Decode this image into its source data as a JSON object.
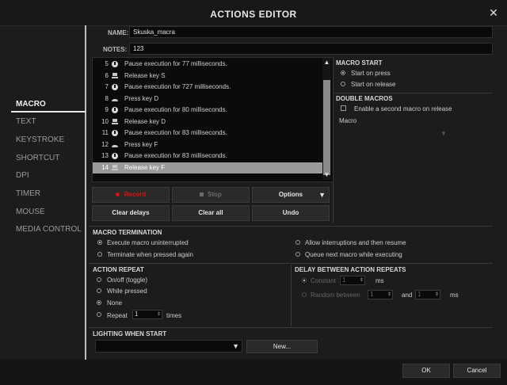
{
  "window": {
    "title": "ACTIONS EDITOR",
    "close_icon": "close-icon"
  },
  "sidebar": {
    "items": [
      {
        "label": "MACRO",
        "active": true
      },
      {
        "label": "TEXT"
      },
      {
        "label": "KEYSTROKE"
      },
      {
        "label": "SHORTCUT"
      },
      {
        "label": "DPI"
      },
      {
        "label": "TIMER"
      },
      {
        "label": "MOUSE"
      },
      {
        "label": "MEDIA CONTROL"
      }
    ]
  },
  "form": {
    "name_label": "NAME:",
    "name_value": "Skuska_macra",
    "notes_label": "NOTES:",
    "notes_value": "123"
  },
  "macro_list": {
    "rows": [
      {
        "num": "5",
        "icon": "clock-icon",
        "text": "Pause execution for 77 milliseconds."
      },
      {
        "num": "6",
        "icon": "key-release-icon",
        "text": "Release key S"
      },
      {
        "num": "7",
        "icon": "clock-icon",
        "text": "Pause execution for 727 milliseconds."
      },
      {
        "num": "8",
        "icon": "key-press-icon",
        "text": "Press key D"
      },
      {
        "num": "9",
        "icon": "clock-icon",
        "text": "Pause execution for 80 milliseconds."
      },
      {
        "num": "10",
        "icon": "key-release-icon",
        "text": "Release key D"
      },
      {
        "num": "11",
        "icon": "clock-icon",
        "text": "Pause execution for 83 milliseconds."
      },
      {
        "num": "12",
        "icon": "key-press-icon",
        "text": "Press key F"
      },
      {
        "num": "13",
        "icon": "clock-icon",
        "text": "Pause execution for 83 milliseconds."
      },
      {
        "num": "14",
        "icon": "key-release-icon",
        "text": "Release key F",
        "selected": true
      }
    ]
  },
  "buttons": {
    "record": "Record",
    "stop": "Stop",
    "options": "Options",
    "clear_delays": "Clear delays",
    "clear_all": "Clear all",
    "undo": "Undo"
  },
  "macro_start": {
    "title": "MACRO START",
    "options": [
      {
        "label": "Start on press",
        "selected": true
      },
      {
        "label": "Start on release"
      }
    ]
  },
  "double_macros": {
    "title": "DOUBLE MACROS",
    "enable_label": "Enable a second macro on release",
    "macro_label": "Macro"
  },
  "macro_termination": {
    "title": "MACRO TERMINATION",
    "options": [
      {
        "label": "Execute macro uninterrupted",
        "selected": true
      },
      {
        "label": "Terminate when pressed again"
      },
      {
        "label": "Allow interruptions and then resume"
      },
      {
        "label": "Queue next macro while executing"
      }
    ]
  },
  "action_repeat": {
    "title": "ACTION REPEAT",
    "options": [
      {
        "label": "On/off (toggle)"
      },
      {
        "label": "While pressed"
      },
      {
        "label": "None",
        "selected": true
      },
      {
        "label": "Repeat"
      }
    ],
    "repeat_value": "1",
    "times_label": "times"
  },
  "delay_between": {
    "title": "DELAY BETWEEN ACTION REPEATS",
    "constant_label": "Constant",
    "constant_value": "1",
    "ms_label": "ms",
    "random_label": "Random between",
    "random_from": "1",
    "and_label": "and",
    "random_to": "1"
  },
  "lighting": {
    "title": "LIGHTING WHEN START",
    "new_label": "New..."
  },
  "footer": {
    "ok": "OK",
    "cancel": "Cancel"
  }
}
